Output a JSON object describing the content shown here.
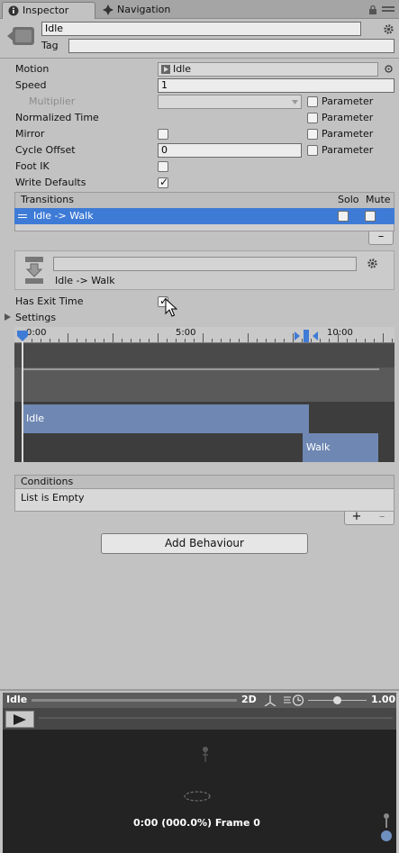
{
  "tabs": [
    {
      "label": "Inspector",
      "icon": "info-icon"
    },
    {
      "label": "Navigation",
      "icon": "navigation-icon"
    }
  ],
  "header": {
    "name": "Idle",
    "tag_label": "Tag",
    "tag_value": ""
  },
  "properties": {
    "motion": {
      "label": "Motion",
      "value": "Idle"
    },
    "speed": {
      "label": "Speed",
      "value": "1"
    },
    "multiplier": {
      "label": "Multiplier",
      "value": ""
    },
    "normalized_time": {
      "label": "Normalized Time"
    },
    "mirror": {
      "label": "Mirror"
    },
    "cycle_offset": {
      "label": "Cycle Offset",
      "value": "0"
    },
    "foot_ik": {
      "label": "Foot IK"
    },
    "write_defaults": {
      "label": "Write Defaults"
    },
    "parameter_label": "Parameter"
  },
  "transitions": {
    "header": "Transitions",
    "solo": "Solo",
    "mute": "Mute",
    "items": [
      {
        "label": "Idle -> Walk"
      }
    ],
    "remove_label": "–"
  },
  "transition_panel": {
    "name_value": "",
    "subtitle": "Idle -> Walk"
  },
  "exit_time": {
    "label": "Has Exit Time",
    "checked": true
  },
  "settings_label": "Settings",
  "timeline": {
    "tick_labels": [
      "0:00",
      "5:00",
      "10:00"
    ],
    "clips": [
      {
        "label": "Idle"
      },
      {
        "label": "Walk"
      }
    ]
  },
  "conditions": {
    "header": "Conditions",
    "empty_text": "List is Empty",
    "add_label": "+",
    "remove_label": "–"
  },
  "add_behaviour": "Add Behaviour",
  "preview": {
    "title": "Idle",
    "mode_2d": "2D",
    "speed_value": "1.00",
    "status": "0:00 (000.0%) Frame 0"
  },
  "colors": {
    "selection": "#3e7bd6",
    "clip": "#6f88b3",
    "preview_bg": "#232323"
  }
}
